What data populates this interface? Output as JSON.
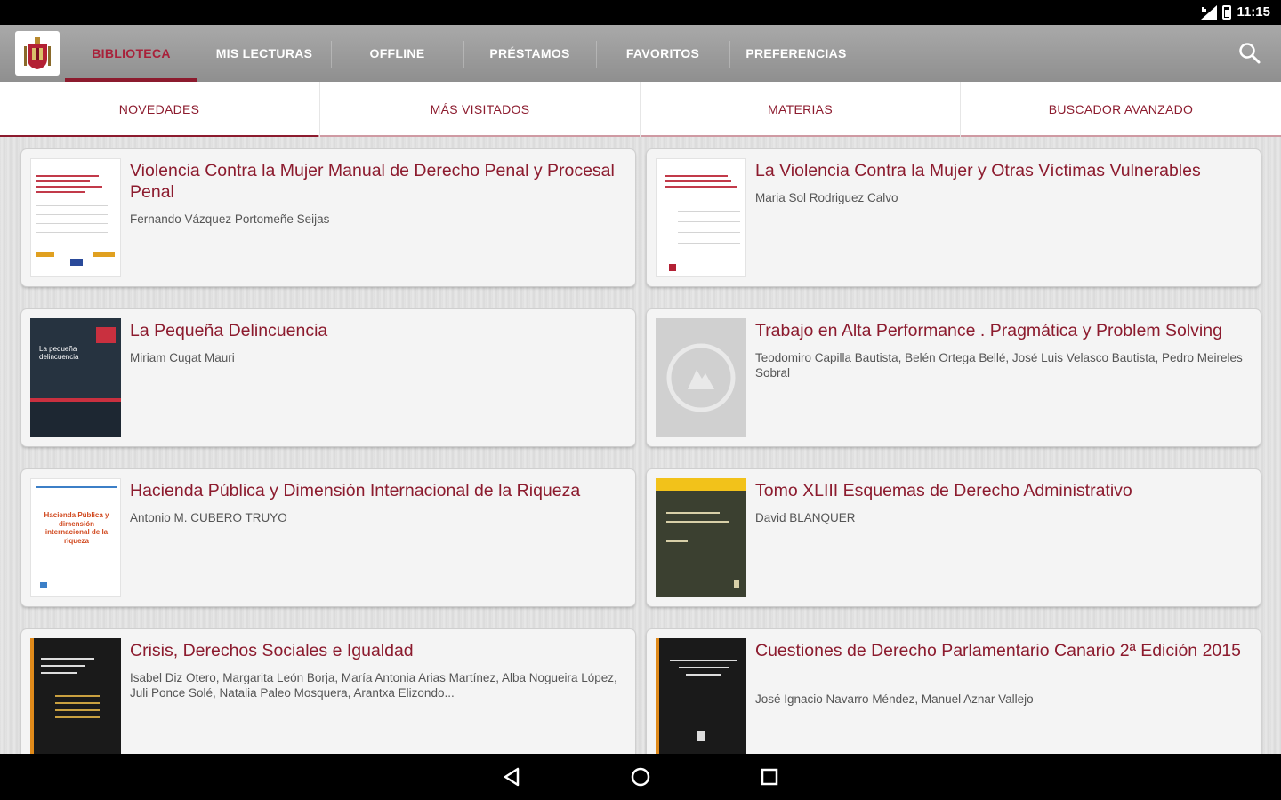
{
  "status_bar": {
    "time": "11:15"
  },
  "app_bar": {
    "tabs": [
      {
        "label": "BIBLIOTECA",
        "active": true
      },
      {
        "label": "MIS LECTURAS",
        "active": false
      },
      {
        "label": "OFFLINE",
        "active": false
      },
      {
        "label": "PRÉSTAMOS",
        "active": false
      },
      {
        "label": "FAVORITOS",
        "active": false
      },
      {
        "label": "PREFERENCIAS",
        "active": false
      }
    ],
    "search_icon": "search-icon"
  },
  "sub_tabs": [
    {
      "label": "NOVEDADES",
      "active": true
    },
    {
      "label": "MÁS VISITADOS",
      "active": false
    },
    {
      "label": "MATERIAS",
      "active": false
    },
    {
      "label": "BUSCADOR AVANZADO",
      "active": false
    }
  ],
  "books": [
    {
      "title": "Violencia Contra la Mujer Manual de Derecho Penal y Procesal Penal",
      "author": "Fernando Vázquez Portomeñe Seijas"
    },
    {
      "title": "La Violencia Contra la Mujer y Otras Víctimas Vulnerables",
      "author": "Maria Sol Rodriguez Calvo"
    },
    {
      "title": "La Pequeña Delincuencia",
      "author": "Miriam Cugat Mauri",
      "cover_text": "La pequeña delincuencia"
    },
    {
      "title": "Trabajo en Alta Performance . Pragmática y Problem Solving",
      "author": "Teodomiro Capilla Bautista, Belén Ortega Bellé, José Luis Velasco Bautista, Pedro Meireles Sobral"
    },
    {
      "title": "Hacienda Pública y Dimensión Internacional de la Riqueza",
      "author": "Antonio M. CUBERO TRUYO",
      "cover_text": "Hacienda Pública y dimensión internacional de la riqueza"
    },
    {
      "title": "Tomo XLIII Esquemas de Derecho Administrativo",
      "author": "David BLANQUER"
    },
    {
      "title": "Crisis, Derechos Sociales e Igualdad",
      "author": "Isabel Diz Otero, Margarita León Borja, María Antonia Arias Martínez, Alba Nogueira López, Juli Ponce Solé, Natalia Paleo Mosquera, Arantxa Elizondo..."
    },
    {
      "title": "Cuestiones de Derecho Parlamentario Canario 2ª Edición 2015",
      "author": "José Ignacio Navarro Méndez, Manuel Aznar Vallejo"
    }
  ],
  "nav_bar": {
    "back": "back-icon",
    "home": "home-icon",
    "recents": "recents-icon"
  },
  "colors": {
    "accent": "#8c1b2e",
    "app_bar": "#9b9b9b"
  }
}
